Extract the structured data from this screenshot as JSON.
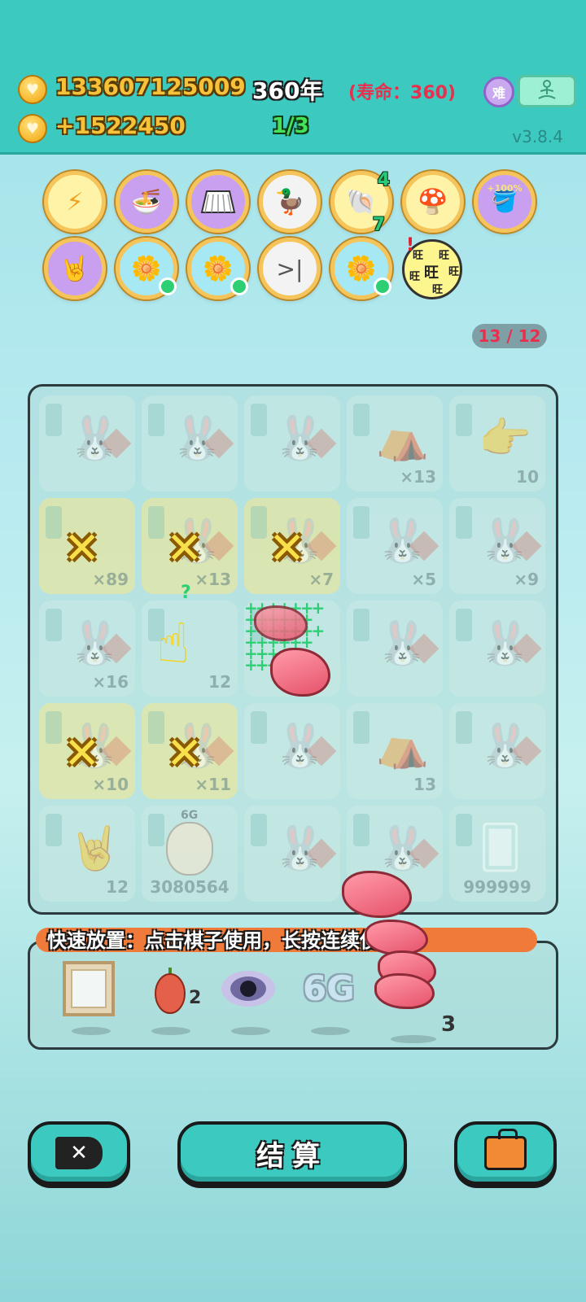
{
  "header": {
    "gold_total": "133607125009",
    "gold_income": "+1522450",
    "year": "360年",
    "lifespan": "(寿命：360)",
    "round": "1/3",
    "version": "v3.8.4",
    "difficulty_badge": "难"
  },
  "buffs": [
    {
      "icon": "lightning-icon",
      "style": "yellow"
    },
    {
      "icon": "bowls-icon",
      "style": "purple"
    },
    {
      "icon": "skirt-icon",
      "style": "purple"
    },
    {
      "icon": "pot-duck-icon",
      "style": "white"
    },
    {
      "icon": "shell-icon",
      "style": "yellow",
      "top_num": "4",
      "bottom_num": "7"
    },
    {
      "icon": "mushroom-cloud-icon",
      "style": "yellow"
    },
    {
      "icon": "gold-bucket-icon",
      "style": "purple",
      "label": "+100%"
    },
    {
      "icon": "rock-hand-icon",
      "style": "purple"
    },
    {
      "icon": "flower-pot-icon",
      "style": "cyan"
    },
    {
      "icon": "flower-pot-icon",
      "style": "cyan"
    },
    {
      "icon": "skip-icon",
      "style": "white"
    },
    {
      "icon": "flower-pot-icon",
      "style": "cyan"
    },
    {
      "icon": "wang-badge-icon",
      "style": "wang",
      "chars": [
        "旺",
        "旺",
        "旺",
        "旺",
        "旺",
        "旺"
      ]
    }
  ],
  "page_counter": "13 / 12",
  "board": {
    "cells": [
      {
        "type": "bunny",
        "count": ""
      },
      {
        "type": "bunny",
        "count": ""
      },
      {
        "type": "bunny",
        "count": ""
      },
      {
        "type": "house",
        "count": "×13"
      },
      {
        "type": "hand",
        "count": "10"
      },
      {
        "type": "x",
        "count": "×89"
      },
      {
        "type": "bunny-x",
        "count": "×13"
      },
      {
        "type": "bunny-x",
        "count": "×7"
      },
      {
        "type": "bunny",
        "count": "×5"
      },
      {
        "type": "bunny",
        "count": "×9"
      },
      {
        "type": "bunny",
        "count": "×16"
      },
      {
        "type": "pointer",
        "count": "12"
      },
      {
        "type": "gift",
        "count": ""
      },
      {
        "type": "bunny",
        "count": ""
      },
      {
        "type": "bunny",
        "count": ""
      },
      {
        "type": "bunny-x",
        "count": "×10"
      },
      {
        "type": "bunny-x",
        "count": "×11"
      },
      {
        "type": "bunny",
        "count": ""
      },
      {
        "type": "house",
        "count": "13"
      },
      {
        "type": "bunny",
        "count": ""
      },
      {
        "type": "rock-hand",
        "count": "12"
      },
      {
        "type": "face",
        "count": "3080564",
        "top": "6G"
      },
      {
        "type": "bunny",
        "count": ""
      },
      {
        "type": "bunny",
        "count": ""
      },
      {
        "type": "cards",
        "count": "999999"
      }
    ],
    "question_mark": "?"
  },
  "quick_place": {
    "tip": "快速放置：点击棋子使用，长按连续使用",
    "items": [
      {
        "name": "mirror-frame",
        "count": ""
      },
      {
        "name": "chili-pepper",
        "count": "2"
      },
      {
        "name": "black-hole",
        "count": ""
      },
      {
        "name": "6g",
        "label": "6G",
        "count": ""
      },
      {
        "name": "liver",
        "count": "3"
      }
    ]
  },
  "bottom": {
    "settle_label": "结算"
  },
  "colors": {
    "header_bg": "#3cc9c0",
    "gold": "#f7c23a",
    "life_red": "#e8304e",
    "round_green": "#46e15a",
    "tip_bar": "#f07a3a"
  }
}
